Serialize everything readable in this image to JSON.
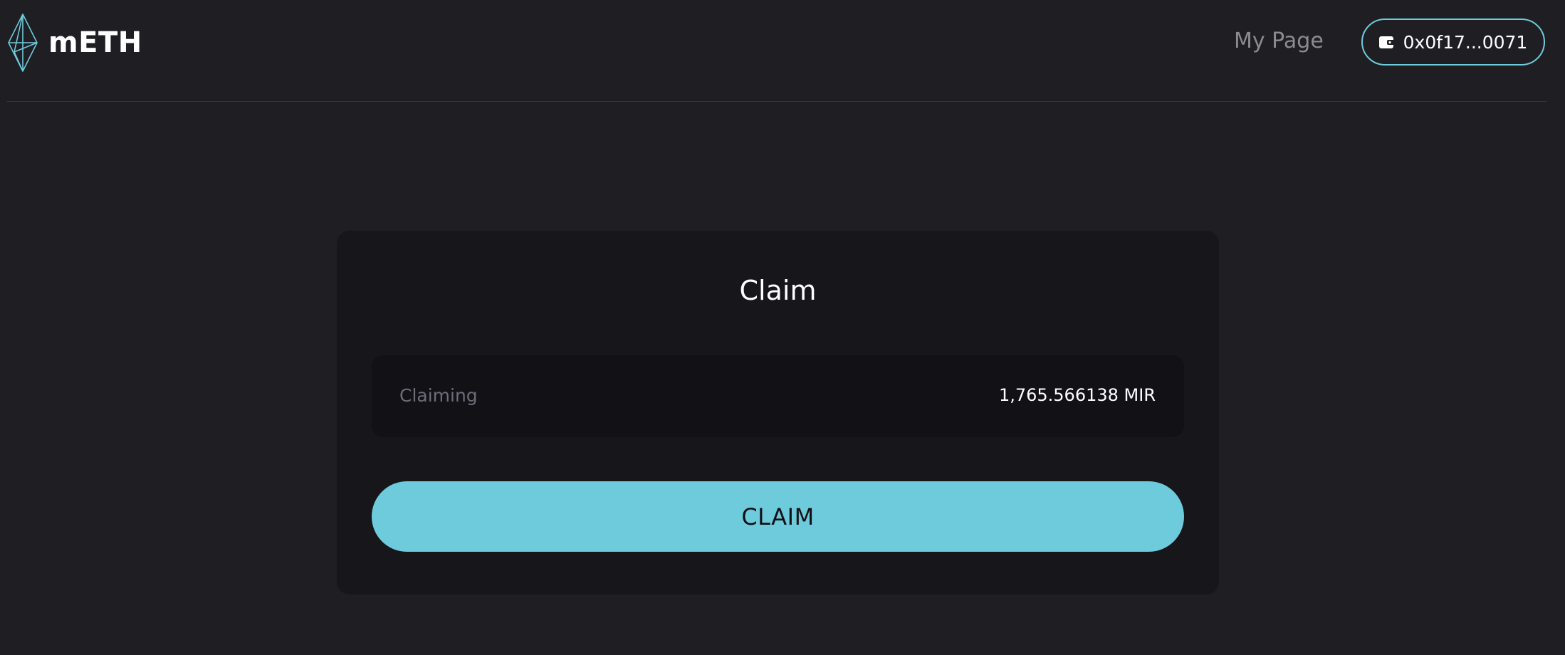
{
  "header": {
    "logo_text": "mETH",
    "logo_icon": "ethereum-diamond-icon",
    "nav_my_page": "My Page",
    "wallet": {
      "icon": "wallet-icon",
      "address": "0x0f17...0071"
    }
  },
  "claim_card": {
    "title": "Claim",
    "claiming_label": "Claiming",
    "claiming_value": "1,765.566138 MIR",
    "claim_button": "CLAIM"
  },
  "colors": {
    "background": "#1f1e23",
    "card": "#17161b",
    "row": "#121116",
    "accent": "#6ecbdc",
    "muted_text": "#8c8b91"
  }
}
